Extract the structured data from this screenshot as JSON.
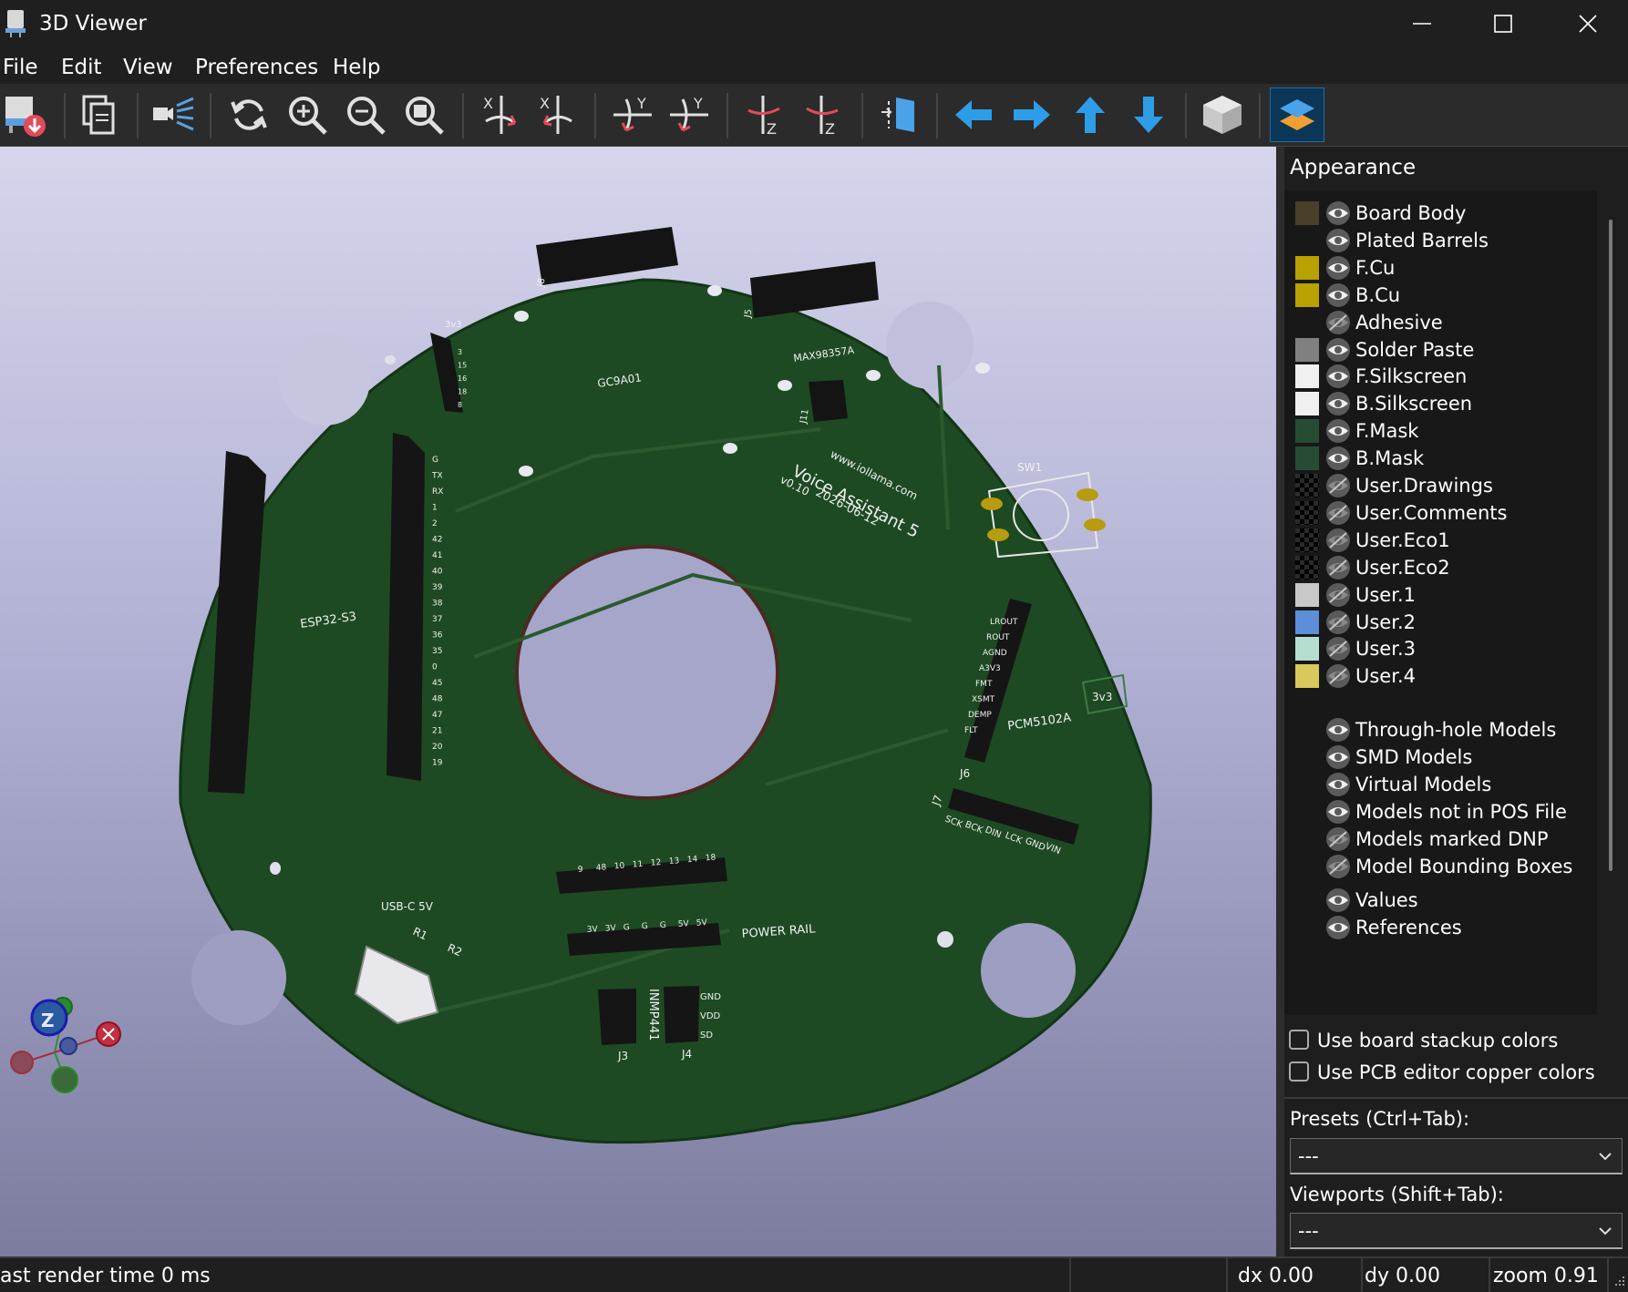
{
  "window": {
    "title": "3D Viewer"
  },
  "menu": [
    "File",
    "Edit",
    "View",
    "Preferences",
    "Help"
  ],
  "toolbar": [
    "export-icon",
    "copy-icon",
    "raytrace-icon",
    "reload-icon",
    "zoom-in-icon",
    "zoom-out-icon",
    "zoom-fit-icon",
    "rotate-x-cw-icon",
    "rotate-x-ccw-icon",
    "rotate-y-cw-icon",
    "rotate-y-ccw-icon",
    "rotate-z-cw-icon",
    "rotate-z-ccw-icon",
    "flip-board-icon",
    "move-left-icon",
    "move-right-icon",
    "move-up-icon",
    "move-down-icon",
    "projection-icon",
    "appearance-icon"
  ],
  "appearance": {
    "title": "Appearance",
    "layers": [
      {
        "label": "Board Body",
        "color": "#4a3f2a",
        "visible": true
      },
      {
        "label": "Plated Barrels",
        "color": "",
        "visible": true
      },
      {
        "label": "F.Cu",
        "color": "#b8a100",
        "visible": true
      },
      {
        "label": "B.Cu",
        "color": "#b8a100",
        "visible": true
      },
      {
        "label": "Adhesive",
        "color": "",
        "visible": false
      },
      {
        "label": "Solder Paste",
        "color": "#808080",
        "visible": true
      },
      {
        "label": "F.Silkscreen",
        "color": "#f0f0f0",
        "visible": true
      },
      {
        "label": "B.Silkscreen",
        "color": "#f0f0f0",
        "visible": true
      },
      {
        "label": "F.Mask",
        "color": "#264d33",
        "visible": true
      },
      {
        "label": "B.Mask",
        "color": "#264d33",
        "visible": true
      },
      {
        "label": "User.Drawings",
        "color": "checker",
        "visible": false
      },
      {
        "label": "User.Comments",
        "color": "checker",
        "visible": false
      },
      {
        "label": "User.Eco1",
        "color": "checker",
        "visible": false
      },
      {
        "label": "User.Eco2",
        "color": "checker",
        "visible": false
      },
      {
        "label": "User.1",
        "color": "#c8c8c8",
        "visible": false
      },
      {
        "label": "User.2",
        "color": "#5b8fd9",
        "visible": false
      },
      {
        "label": "User.3",
        "color": "#b5ddd0",
        "visible": false
      },
      {
        "label": "User.4",
        "color": "#d9c85b",
        "visible": false
      }
    ],
    "models": [
      {
        "label": "Through-hole Models",
        "visible": true
      },
      {
        "label": "SMD Models",
        "visible": true
      },
      {
        "label": "Virtual Models",
        "visible": true
      },
      {
        "label": "Models not in POS File",
        "visible": true
      },
      {
        "label": "Models marked DNP",
        "visible": false
      },
      {
        "label": "Model Bounding Boxes",
        "visible": false
      }
    ],
    "extras": [
      {
        "label": "Values",
        "visible": true
      },
      {
        "label": "References",
        "visible": true
      }
    ],
    "use_stackup_colors": {
      "label": "Use board stackup colors",
      "checked": false
    },
    "use_pcb_copper_colors": {
      "label": "Use PCB editor copper colors",
      "checked": false
    },
    "presets": {
      "label": "Presets (Ctrl+Tab):",
      "value": "---"
    },
    "viewports": {
      "label": "Viewports (Shift+Tab):",
      "value": "---"
    }
  },
  "board": {
    "silk": {
      "title_line1": "www.iollama.com",
      "title_line2": "Voice Assistant 5",
      "version": "v0.10",
      "date": "2026-06-12",
      "esp": "ESP32-S3",
      "gc9a01": "GC9A01",
      "max": "MAX98357A",
      "pcm": "PCM5102A",
      "sw1": "SW1",
      "usb": "USB-C 5V",
      "power_rail": "POWER RAIL",
      "inmp": "INMP441",
      "v3v3_top": "3v3",
      "v3v3_right": "3v3",
      "r1": "R1",
      "r2": "R2",
      "j3": "J3",
      "j4": "J4",
      "j5": "J5",
      "j6": "J6",
      "j7": "J7",
      "j8": "J8",
      "j11": "J11"
    },
    "esp_pins_right": [
      "G",
      "TX",
      "RX",
      "1",
      "2",
      "42",
      "41",
      "40",
      "39",
      "38",
      "37",
      "36",
      "35",
      "0",
      "45",
      "48",
      "47",
      "21",
      "20",
      "19"
    ],
    "top_pins": [
      "3",
      "15",
      "16",
      "18",
      "8"
    ],
    "pcm_pins": [
      "LROUT",
      "ROUT",
      "AGND",
      "A3V3",
      "FMT",
      "XSMT",
      "DEMP",
      "FLT"
    ],
    "j7_pins": [
      "SCK",
      "BCK",
      "DIN",
      "LCK",
      "GND",
      "VIN"
    ],
    "rail_pins": [
      "3V",
      "3V",
      "G",
      "G",
      "G",
      "5V",
      "5V"
    ],
    "top_rail_pins": [
      "9",
      "48",
      "10",
      "11",
      "12",
      "13",
      "14",
      "18"
    ],
    "inmp_pins": [
      "GND",
      "VDD",
      "SD"
    ]
  },
  "axes": {
    "z": "Z"
  },
  "status": {
    "render": "ast render time 0 ms",
    "dx": "dx 0.00",
    "dy": "dy 0.00",
    "zoom": "zoom 0.91"
  }
}
